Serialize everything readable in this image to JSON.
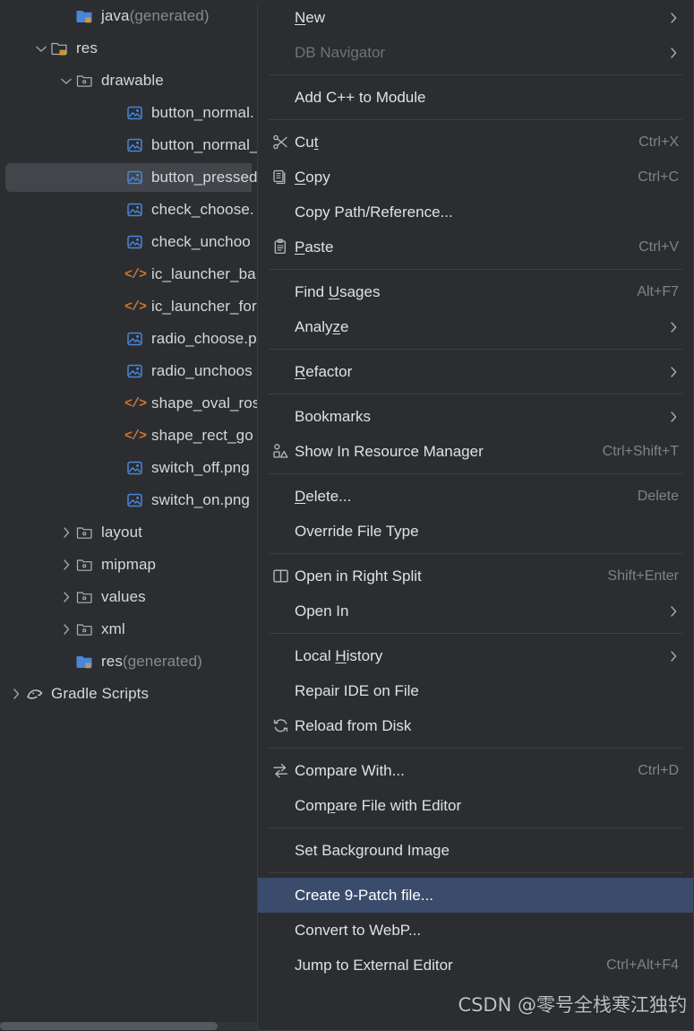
{
  "window": {
    "background": "#2b2d30",
    "menu_background": "#2b2d30",
    "selection_blue": "#3a4b6b",
    "tree_selection_gray": "#43454a",
    "xml_icon_color": "#cc7832",
    "png_icon_color": "#4a86d8"
  },
  "project_tree": {
    "items": [
      {
        "label": "java",
        "suffix": " (generated)",
        "icon": "folder-generated-icon",
        "indent": 2,
        "chevron": "none",
        "selected": false
      },
      {
        "label": "res",
        "suffix": "",
        "icon": "folder-res-icon",
        "indent": 1,
        "chevron": "expanded",
        "selected": false
      },
      {
        "label": "drawable",
        "suffix": "",
        "icon": "folder-resource-icon",
        "indent": 2,
        "chevron": "expanded",
        "selected": false
      },
      {
        "label": "button_normal.",
        "suffix": "",
        "icon": "png-file-icon",
        "indent": 4,
        "chevron": "none",
        "selected": false
      },
      {
        "label": "button_normal_",
        "suffix": "",
        "icon": "png-file-icon",
        "indent": 4,
        "chevron": "none",
        "selected": false
      },
      {
        "label": "button_pressed",
        "suffix": "",
        "icon": "png-file-icon",
        "indent": 4,
        "chevron": "none",
        "selected": true
      },
      {
        "label": "check_choose.",
        "suffix": "",
        "icon": "png-file-icon",
        "indent": 4,
        "chevron": "none",
        "selected": false
      },
      {
        "label": "check_unchoo",
        "suffix": "",
        "icon": "png-file-icon",
        "indent": 4,
        "chevron": "none",
        "selected": false
      },
      {
        "label": "ic_launcher_ba",
        "suffix": "",
        "icon": "xml-file-icon",
        "indent": 4,
        "chevron": "none",
        "selected": false
      },
      {
        "label": "ic_launcher_for",
        "suffix": "",
        "icon": "xml-file-icon",
        "indent": 4,
        "chevron": "none",
        "selected": false
      },
      {
        "label": "radio_choose.p",
        "suffix": "",
        "icon": "png-file-icon",
        "indent": 4,
        "chevron": "none",
        "selected": false
      },
      {
        "label": "radio_unchoos",
        "suffix": "",
        "icon": "png-file-icon",
        "indent": 4,
        "chevron": "none",
        "selected": false
      },
      {
        "label": "shape_oval_ros",
        "suffix": "",
        "icon": "xml-file-icon",
        "indent": 4,
        "chevron": "none",
        "selected": false
      },
      {
        "label": "shape_rect_go",
        "suffix": "",
        "icon": "xml-file-icon",
        "indent": 4,
        "chevron": "none",
        "selected": false
      },
      {
        "label": "switch_off.png",
        "suffix": "",
        "icon": "png-file-icon",
        "indent": 4,
        "chevron": "none",
        "selected": false
      },
      {
        "label": "switch_on.png",
        "suffix": "",
        "icon": "png-file-icon",
        "indent": 4,
        "chevron": "none",
        "selected": false
      },
      {
        "label": "layout",
        "suffix": "",
        "icon": "folder-resource-icon",
        "indent": 2,
        "chevron": "collapsed",
        "selected": false
      },
      {
        "label": "mipmap",
        "suffix": "",
        "icon": "folder-resource-icon",
        "indent": 2,
        "chevron": "collapsed",
        "selected": false
      },
      {
        "label": "values",
        "suffix": "",
        "icon": "folder-resource-icon",
        "indent": 2,
        "chevron": "collapsed",
        "selected": false
      },
      {
        "label": "xml",
        "suffix": "",
        "icon": "folder-resource-icon",
        "indent": 2,
        "chevron": "collapsed",
        "selected": false
      },
      {
        "label": "res",
        "suffix": " (generated)",
        "icon": "folder-generated-icon",
        "indent": 2,
        "chevron": "none",
        "selected": false
      },
      {
        "label": "Gradle Scripts",
        "suffix": "",
        "icon": "gradle-icon",
        "indent": 0,
        "chevron": "collapsed",
        "selected": false
      }
    ]
  },
  "context_menu": {
    "entries": [
      {
        "kind": "item",
        "label": "New",
        "mnemonic": 0,
        "icon": null,
        "accel": "",
        "arrow": true,
        "disabled": false,
        "highlight": false
      },
      {
        "kind": "item",
        "label": "DB Navigator",
        "mnemonic": -1,
        "icon": null,
        "accel": "",
        "arrow": true,
        "disabled": true,
        "highlight": false
      },
      {
        "kind": "separator"
      },
      {
        "kind": "item",
        "label": "Add C++ to Module",
        "mnemonic": -1,
        "icon": null,
        "accel": "",
        "arrow": false,
        "disabled": false,
        "highlight": false
      },
      {
        "kind": "separator"
      },
      {
        "kind": "item",
        "label": "Cut",
        "mnemonic": 2,
        "icon": "scissors-icon",
        "accel": "Ctrl+X",
        "arrow": false,
        "disabled": false,
        "highlight": false
      },
      {
        "kind": "item",
        "label": "Copy",
        "mnemonic": 0,
        "icon": "copy-icon",
        "accel": "Ctrl+C",
        "arrow": false,
        "disabled": false,
        "highlight": false
      },
      {
        "kind": "item",
        "label": "Copy Path/Reference...",
        "mnemonic": -1,
        "icon": null,
        "accel": "",
        "arrow": false,
        "disabled": false,
        "highlight": false
      },
      {
        "kind": "item",
        "label": "Paste",
        "mnemonic": 0,
        "icon": "clipboard-icon",
        "accel": "Ctrl+V",
        "arrow": false,
        "disabled": false,
        "highlight": false
      },
      {
        "kind": "separator"
      },
      {
        "kind": "item",
        "label": "Find Usages",
        "mnemonic": 5,
        "icon": null,
        "accel": "Alt+F7",
        "arrow": false,
        "disabled": false,
        "highlight": false
      },
      {
        "kind": "item",
        "label": "Analyze",
        "mnemonic": 5,
        "icon": null,
        "accel": "",
        "arrow": true,
        "disabled": false,
        "highlight": false
      },
      {
        "kind": "separator"
      },
      {
        "kind": "item",
        "label": "Refactor",
        "mnemonic": 0,
        "icon": null,
        "accel": "",
        "arrow": true,
        "disabled": false,
        "highlight": false
      },
      {
        "kind": "separator"
      },
      {
        "kind": "item",
        "label": "Bookmarks",
        "mnemonic": -1,
        "icon": null,
        "accel": "",
        "arrow": true,
        "disabled": false,
        "highlight": false
      },
      {
        "kind": "item",
        "label": "Show In Resource Manager",
        "mnemonic": -1,
        "icon": "shapes-icon",
        "accel": "Ctrl+Shift+T",
        "arrow": false,
        "disabled": false,
        "highlight": false
      },
      {
        "kind": "separator"
      },
      {
        "kind": "item",
        "label": "Delete...",
        "mnemonic": 0,
        "icon": null,
        "accel": "Delete",
        "arrow": false,
        "disabled": false,
        "highlight": false
      },
      {
        "kind": "item",
        "label": "Override File Type",
        "mnemonic": -1,
        "icon": null,
        "accel": "",
        "arrow": false,
        "disabled": false,
        "highlight": false
      },
      {
        "kind": "separator"
      },
      {
        "kind": "item",
        "label": "Open in Right Split",
        "mnemonic": -1,
        "icon": "split-view-icon",
        "accel": "Shift+Enter",
        "arrow": false,
        "disabled": false,
        "highlight": false
      },
      {
        "kind": "item",
        "label": "Open In",
        "mnemonic": -1,
        "icon": null,
        "accel": "",
        "arrow": true,
        "disabled": false,
        "highlight": false
      },
      {
        "kind": "separator"
      },
      {
        "kind": "item",
        "label": "Local History",
        "mnemonic": 6,
        "icon": null,
        "accel": "",
        "arrow": true,
        "disabled": false,
        "highlight": false
      },
      {
        "kind": "item",
        "label": "Repair IDE on File",
        "mnemonic": -1,
        "icon": null,
        "accel": "",
        "arrow": false,
        "disabled": false,
        "highlight": false
      },
      {
        "kind": "item",
        "label": "Reload from Disk",
        "mnemonic": -1,
        "icon": "refresh-icon",
        "accel": "",
        "arrow": false,
        "disabled": false,
        "highlight": false
      },
      {
        "kind": "separator"
      },
      {
        "kind": "item",
        "label": "Compare With...",
        "mnemonic": -1,
        "icon": "compare-icon",
        "accel": "Ctrl+D",
        "arrow": false,
        "disabled": false,
        "highlight": false
      },
      {
        "kind": "item",
        "label": "Compare File with Editor",
        "mnemonic": 3,
        "icon": null,
        "accel": "",
        "arrow": false,
        "disabled": false,
        "highlight": false
      },
      {
        "kind": "separator"
      },
      {
        "kind": "item",
        "label": "Set Background Image",
        "mnemonic": -1,
        "icon": null,
        "accel": "",
        "arrow": false,
        "disabled": false,
        "highlight": false
      },
      {
        "kind": "separator"
      },
      {
        "kind": "item",
        "label": "Create 9-Patch file...",
        "mnemonic": -1,
        "icon": null,
        "accel": "",
        "arrow": false,
        "disabled": false,
        "highlight": true
      },
      {
        "kind": "item",
        "label": "Convert to WebP...",
        "mnemonic": -1,
        "icon": null,
        "accel": "",
        "arrow": false,
        "disabled": false,
        "highlight": false
      },
      {
        "kind": "item",
        "label": "Jump to External Editor",
        "mnemonic": -1,
        "icon": null,
        "accel": "Ctrl+Alt+F4",
        "arrow": false,
        "disabled": false,
        "highlight": false
      }
    ]
  },
  "watermark": {
    "text": "CSDN @零号全栈寒江独钓"
  }
}
